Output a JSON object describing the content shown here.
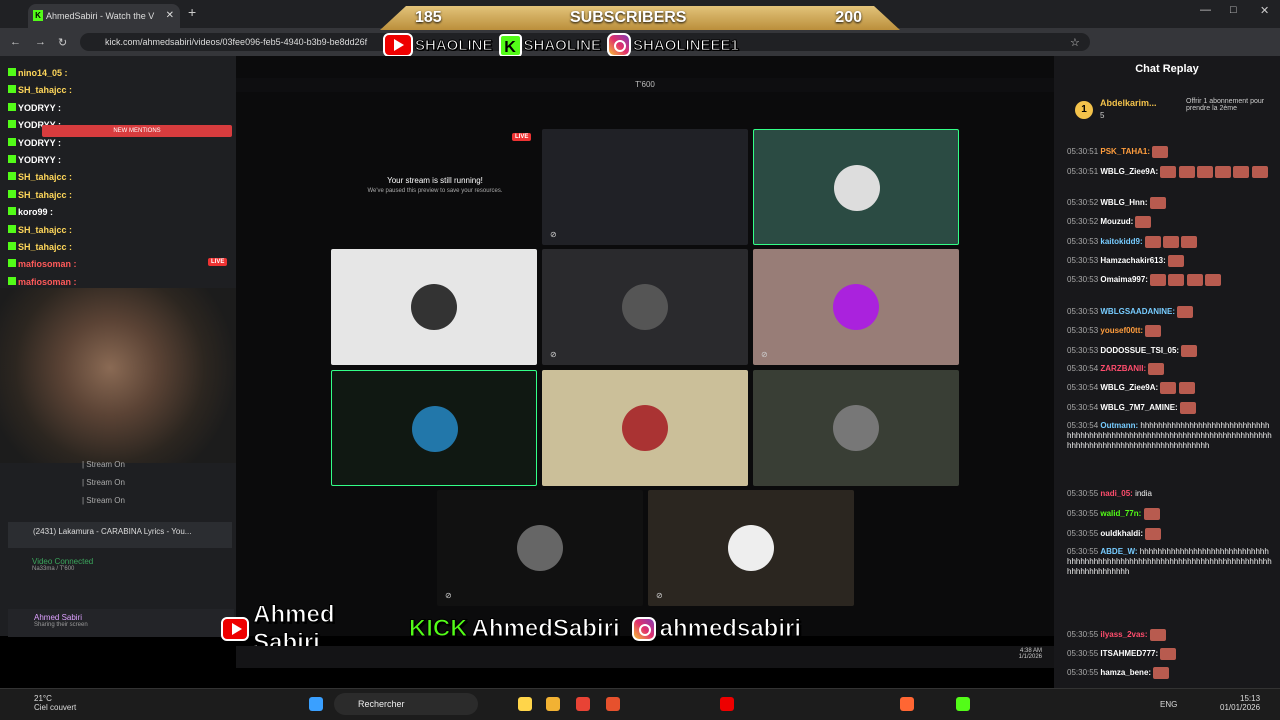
{
  "browser": {
    "tab_title": "AhmedSabiri - Watch the V",
    "tab_icon_letter": "K",
    "url": "kick.com/ahmedsabiri/videos/03fee096-feb5-4940-b3b9-be8dd26f"
  },
  "overlay": {
    "subscribers_left": "185",
    "subscribers_label": "SUBSCRIBERS",
    "subscribers_right": "200",
    "top_socials": [
      "SHAOLINE",
      "SHAOLINE",
      "SHAOLINEEE1"
    ],
    "bottom_socials": [
      "Ahmed Sabiri",
      "AhmedSabiri",
      "ahmedsabiri"
    ],
    "kick_word": "KICK"
  },
  "left": {
    "chat": [
      {
        "user": "nino14_05 :",
        "color": "#ffd75a"
      },
      {
        "user": "SH_tahajcc :",
        "color": "#ffd75a"
      },
      {
        "user": "YODRYY :",
        "color": "#fff"
      },
      {
        "user": "YODRYY :",
        "color": "#fff"
      },
      {
        "user": "YODRYY :",
        "color": "#fff"
      },
      {
        "user": "YODRYY :",
        "color": "#fff"
      },
      {
        "user": "SH_tahajcc :",
        "color": "#ffd75a"
      },
      {
        "user": "SH_tahajcc :",
        "color": "#ffd75a"
      },
      {
        "user": "koro99 :",
        "color": "#fff"
      },
      {
        "user": "SH_tahajcc :",
        "color": "#ffd75a"
      },
      {
        "user": "SH_tahajcc :",
        "color": "#ffd75a"
      },
      {
        "user": "mafiosoman :",
        "color": "#ff5a5a"
      },
      {
        "user": "mafiosoman :",
        "color": "#ff5a5a"
      },
      {
        "user": "mafiosoman :",
        "color": "#ff5a5a"
      }
    ],
    "new_mentions": "NEW MENTIONS",
    "live": "LIVE",
    "stream_on": "| Stream On",
    "track": "(2431) Lakamura - CARABINA Lyrics - You...",
    "video_connected": "Video Connected",
    "channel": "Na33ma / T'600",
    "user": "Ahmed Sabiri",
    "sharing": "Sharing their screen"
  },
  "main": {
    "title": "T'600",
    "paused_title": "Your stream is still running!",
    "paused_sub": "We've paused this preview to save your resources.",
    "live": "LIVE"
  },
  "chat": {
    "title": "Chat Replay",
    "pinned_user": "Abdelkarim...",
    "pinned_count": "5",
    "pinned_text": "Offrir 1 abonnement pour prendre la 2ème",
    "rank": "1",
    "messages": [
      {
        "time": "05:30:51",
        "user": "PSK_TAHA1:",
        "color": "#ff9d3d",
        "text": "",
        "emotes": 1
      },
      {
        "time": "05:30:51",
        "user": "WBLG_Ziee9A:",
        "color": "#fff",
        "text": "",
        "emotes": 6
      },
      {
        "time": "05:30:52",
        "user": "WBLG_Hnn:",
        "color": "#fff",
        "text": "",
        "emotes": 1
      },
      {
        "time": "05:30:52",
        "user": "Mouzud:",
        "color": "#fff",
        "text": "",
        "emotes": 1
      },
      {
        "time": "05:30:53",
        "user": "kaitokidd9:",
        "color": "#7cf",
        "text": "",
        "emotes": 3
      },
      {
        "time": "05:30:53",
        "user": "Hamzachakir613:",
        "color": "#fff",
        "text": "",
        "emotes": 1
      },
      {
        "time": "05:30:53",
        "user": "Omaima997:",
        "color": "#fff",
        "text": "",
        "emotes": 4
      },
      {
        "time": "05:30:53",
        "user": "WBLGSAADANINE:",
        "color": "#7cf",
        "text": "",
        "emotes": 1
      },
      {
        "time": "05:30:53",
        "user": "yousef00tt:",
        "color": "#ff9d3d",
        "text": "",
        "emotes": 1
      },
      {
        "time": "05:30:53",
        "user": "DODOSSUE_TSI_05:",
        "color": "#fff",
        "text": "",
        "emotes": 1
      },
      {
        "time": "05:30:54",
        "user": "ZARZBANII:",
        "color": "#ff4d6d",
        "text": "",
        "emotes": 1
      },
      {
        "time": "05:30:54",
        "user": "WBLG_Ziee9A:",
        "color": "#fff",
        "text": "",
        "emotes": 2
      },
      {
        "time": "05:30:54",
        "user": "WBLG_7M7_AMINE:",
        "color": "#fff",
        "text": "",
        "emotes": 1
      },
      {
        "time": "05:30:54",
        "user": "Outmann:",
        "color": "#7cf",
        "text": "hhhhhhhhhhhhhhhhhhhhhhhhhhhhhhhhhhhhhhhhhhhhhhhhhhhhhhhhhhhhhhhhhhhhhhhhhhhhhhhhhhhhhhhhhhhhhhhhhhhhhhhhhhh",
        "emotes": 0
      },
      {
        "time": "05:30:55",
        "user": "nadi_05:",
        "color": "#ff4d6d",
        "text": "india",
        "emotes": 0
      },
      {
        "time": "05:30:55",
        "user": "walid_77n:",
        "color": "#53fc18",
        "text": "",
        "emotes": 1
      },
      {
        "time": "05:30:55",
        "user": "ouldkhaldi:",
        "color": "#fff",
        "text": "",
        "emotes": 1
      },
      {
        "time": "05:30:55",
        "user": "ABDE_W:",
        "color": "#7cf",
        "text": "hhhhhhhhhhhhhhhhhhhhhhhhhhhhhhhhhhhhhhhhhhhhhhhhhhhhhhhhhhhhhhhhhhhhhhhhhhhhhhhhhhhhhhhhh",
        "emotes": 0
      },
      {
        "time": "05:30:55",
        "user": "ilyass_2vas:",
        "color": "#ff4d6d",
        "text": "",
        "emotes": 1
      },
      {
        "time": "05:30:55",
        "user": "ITSAHMED777:",
        "color": "#fff",
        "text": "",
        "emotes": 1
      },
      {
        "time": "05:30:55",
        "user": "hamza_bene:",
        "color": "#fff",
        "text": "",
        "emotes": 1
      }
    ]
  },
  "taskbar": {
    "temp": "21°C",
    "weather": "Ciel couvert",
    "search": "Rechercher",
    "lang": "ENG",
    "time": "15:13",
    "date": "01/01/2026",
    "inner_time": "4:38 AM",
    "inner_date": "1/1/2026"
  }
}
